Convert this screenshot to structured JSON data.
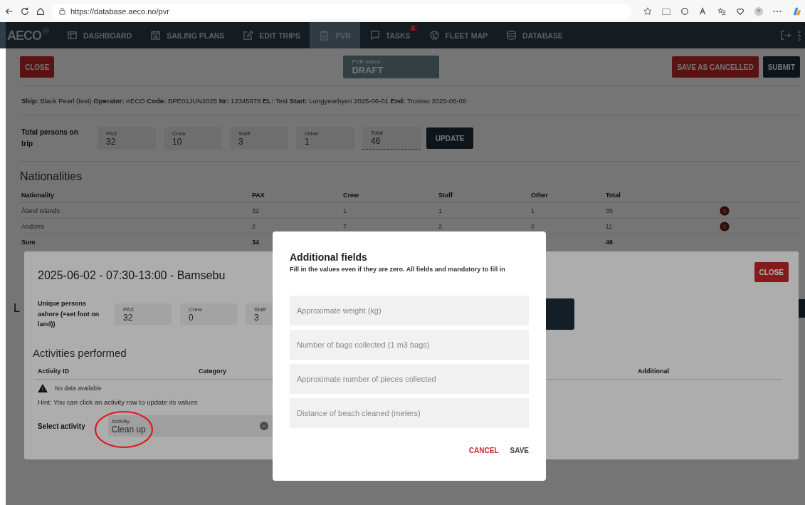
{
  "browser": {
    "url": "https://database.aeco.no/pvr"
  },
  "nav": {
    "logo": "AECO",
    "items": [
      {
        "label": "DASHBOARD",
        "selected": false
      },
      {
        "label": "SAILING PLANS",
        "selected": false
      },
      {
        "label": "EDIT TRIPS",
        "selected": false
      },
      {
        "label": "PVR",
        "selected": true
      },
      {
        "label": "TASKS",
        "selected": false,
        "badge": "1"
      },
      {
        "label": "FLEET MAP",
        "selected": false
      },
      {
        "label": "DATABASE",
        "selected": false
      }
    ]
  },
  "toolbar": {
    "close": "CLOSE",
    "status": {
      "label": "PVR status",
      "value": "DRAFT"
    },
    "buttons": [
      "SAVE AS CANCELLED",
      "SUBMIT"
    ]
  },
  "info": "**Ship:** Black Pearl (test) **Operator:** AECO **Code:** BPE01JUN2025 **Nr:** 12345678 **EL:** Test **Start:** Longyearbyen 2025-06-01 **End:** Tromso 2025-06-08",
  "totals": {
    "label": "Total persons on trip",
    "fields": [
      {
        "label": "PAX",
        "value": "32"
      },
      {
        "label": "Crew",
        "value": "10"
      },
      {
        "label": "Staff",
        "value": "3"
      },
      {
        "label": "Other",
        "value": "1"
      },
      {
        "label": "Total",
        "value": "46"
      }
    ],
    "button": "UPDATE"
  },
  "nationalities": {
    "title": "Nationalities",
    "columns": [
      "Nationality",
      "PAX",
      "Crew",
      "Staff",
      "Other",
      "Total"
    ],
    "rows": [
      [
        "Åland Islands",
        "32",
        "1",
        "1",
        "1",
        "35"
      ],
      [
        "Andorra",
        "2",
        "7",
        "2",
        "0",
        "11"
      ]
    ],
    "sum": [
      "Sum",
      "34",
      "46"
    ]
  },
  "next_section": {
    "title": "L"
  },
  "activity_dialog": {
    "title": "2025-06-02 - 07:30-13:00 - Bamsebu",
    "close": "CLOSE",
    "persons": {
      "label": "Unique persons ashore (=set foot on land))",
      "fields": [
        {
          "label": "PAX",
          "value": "32"
        },
        {
          "label": "Crew",
          "value": "0"
        },
        {
          "label": "Staff",
          "value": "3"
        }
      ]
    },
    "activities": {
      "title": "Activities performed",
      "columns": [
        "Activity ID",
        "Category",
        "Additional"
      ],
      "empty": "No data available",
      "hint": "Hint: You can click an activity row to update its values"
    },
    "select": {
      "label": "Select activity",
      "field": {
        "label": "Activity",
        "value": "Clean up"
      }
    }
  },
  "fields_dialog": {
    "title": "Additional fields",
    "subtitle": "Fill in the values even if they are zero. All fields and mandatory to fill in",
    "fields": [
      {
        "placeholder": "Approximate weight (kg)"
      },
      {
        "placeholder": "Number of bags collected (1 m3 bags)"
      },
      {
        "placeholder": "Approximate number of pieces collected"
      },
      {
        "placeholder": "Distance of beach cleaned (meters)"
      }
    ],
    "buttons": [
      {
        "label": "CANCEL",
        "kind": "cancel"
      },
      {
        "label": "SAVE",
        "kind": "save"
      }
    ]
  }
}
